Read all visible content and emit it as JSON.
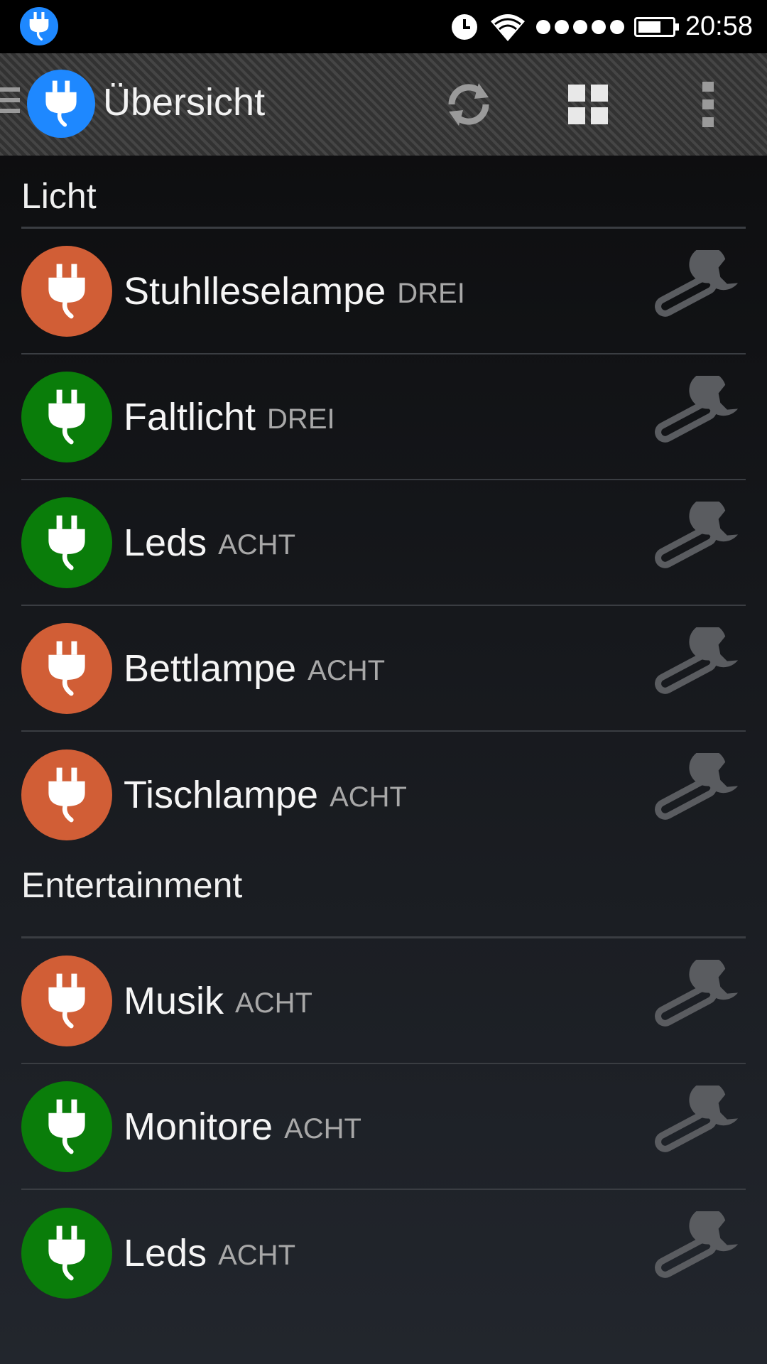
{
  "status_bar": {
    "time": "20:58",
    "app_icon": "plug-icon",
    "alarm_icon": "alarm-clock-icon",
    "wifi_icon": "wifi-icon",
    "signal_icon": "signal-dots-icon",
    "battery_icon": "battery-icon"
  },
  "action_bar": {
    "title": "Übersicht",
    "menu_icon": "hamburger-icon",
    "logo_icon": "plug-icon",
    "actions": [
      "refresh-icon",
      "grid-view-icon",
      "overflow-menu-icon"
    ]
  },
  "colors": {
    "on": "#0a7d0a",
    "off": "#d15e36",
    "accent": "#1e88ff",
    "wrench": "#5a5c60"
  },
  "sections": [
    {
      "title": "Licht",
      "items": [
        {
          "name": "Stuhlleselampe",
          "room": "DREI",
          "state": "off"
        },
        {
          "name": "Faltlicht",
          "room": "DREI",
          "state": "on"
        },
        {
          "name": "Leds",
          "room": "ACHT",
          "state": "on"
        },
        {
          "name": "Bettlampe",
          "room": "ACHT",
          "state": "off"
        },
        {
          "name": "Tischlampe",
          "room": "ACHT",
          "state": "off"
        }
      ]
    },
    {
      "title": "Entertainment",
      "items": [
        {
          "name": "Musik",
          "room": "ACHT",
          "state": "off"
        },
        {
          "name": "Monitore",
          "room": "ACHT",
          "state": "on"
        },
        {
          "name": "Leds",
          "room": "ACHT",
          "state": "on"
        }
      ]
    }
  ]
}
